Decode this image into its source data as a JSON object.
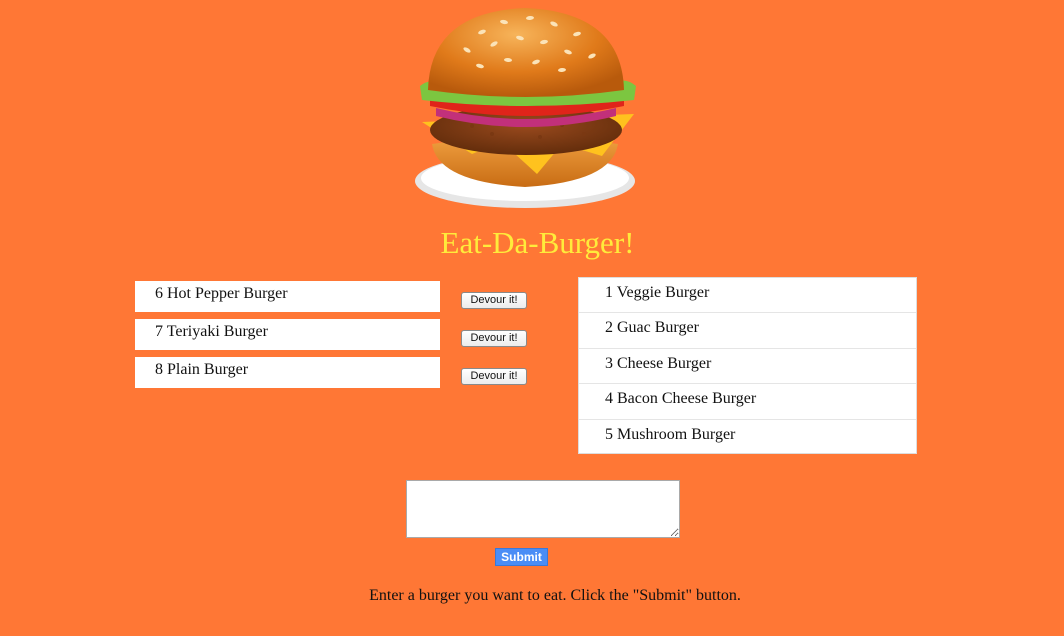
{
  "header": {
    "logo_icon": "hamburger-logo-icon",
    "title": "Eat-Da-Burger!",
    "title_color": "#FFEB3B"
  },
  "colors": {
    "background": "#FF7735",
    "submit_button": "#4A8DF6"
  },
  "uneaten": {
    "items": [
      {
        "label": "6 Hot Pepper Burger",
        "button": "Devour it!"
      },
      {
        "label": "7 Teriyaki Burger",
        "button": "Devour it!"
      },
      {
        "label": "8 Plain Burger",
        "button": "Devour it!"
      }
    ]
  },
  "eaten": {
    "items": [
      {
        "label": "1 Veggie Burger"
      },
      {
        "label": "2 Guac Burger"
      },
      {
        "label": "3 Cheese Burger"
      },
      {
        "label": "4 Bacon Cheese Burger"
      },
      {
        "label": "5 Mushroom Burger"
      }
    ]
  },
  "form": {
    "input_value": "",
    "submit_label": "Submit",
    "instructions": "Enter a burger you want to eat. Click the \"Submit\" button."
  }
}
